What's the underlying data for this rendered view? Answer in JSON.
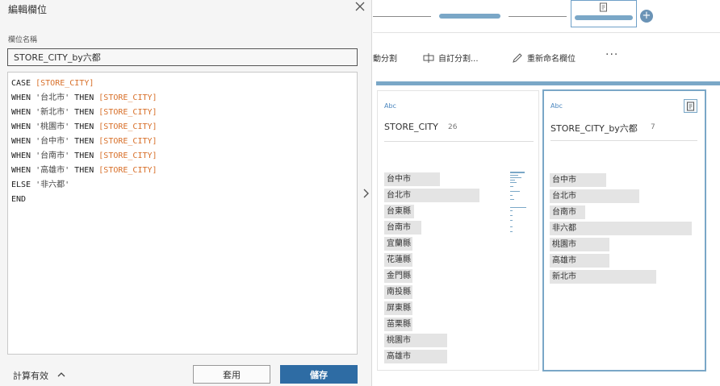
{
  "dialog": {
    "title": "編輯欄位",
    "field_label": "欄位名稱",
    "field_name_value": "STORE_CITY_by六都",
    "code_lines": [
      [
        {
          "t": "CASE ",
          "c": "kw"
        },
        {
          "t": "[STORE_CITY]",
          "c": "field"
        }
      ],
      [
        {
          "t": "WHEN ",
          "c": "kw"
        },
        {
          "t": "'台北市'",
          "c": "str"
        },
        {
          "t": " THEN ",
          "c": "kw"
        },
        {
          "t": "[STORE_CITY]",
          "c": "field"
        }
      ],
      [
        {
          "t": "WHEN ",
          "c": "kw"
        },
        {
          "t": "'新北市'",
          "c": "str"
        },
        {
          "t": " THEN ",
          "c": "kw"
        },
        {
          "t": "[STORE_CITY]",
          "c": "field"
        }
      ],
      [
        {
          "t": "WHEN ",
          "c": "kw"
        },
        {
          "t": "'桃園市'",
          "c": "str"
        },
        {
          "t": " THEN ",
          "c": "kw"
        },
        {
          "t": "[STORE_CITY]",
          "c": "field"
        }
      ],
      [
        {
          "t": "WHEN ",
          "c": "kw"
        },
        {
          "t": "'台中市'",
          "c": "str"
        },
        {
          "t": " THEN ",
          "c": "kw"
        },
        {
          "t": "[STORE_CITY]",
          "c": "field"
        }
      ],
      [
        {
          "t": "WHEN ",
          "c": "kw"
        },
        {
          "t": "'台南市'",
          "c": "str"
        },
        {
          "t": " THEN ",
          "c": "kw"
        },
        {
          "t": "[STORE_CITY]",
          "c": "field"
        }
      ],
      [
        {
          "t": "WHEN ",
          "c": "kw"
        },
        {
          "t": "'高雄市'",
          "c": "str"
        },
        {
          "t": " THEN ",
          "c": "kw"
        },
        {
          "t": "[STORE_CITY]",
          "c": "field"
        }
      ],
      [
        {
          "t": "ELSE ",
          "c": "kw"
        },
        {
          "t": "'非六都'",
          "c": "str"
        }
      ],
      [
        {
          "t": "END",
          "c": "kw"
        }
      ]
    ],
    "valid_label": "計算有效",
    "apply_label": "套用",
    "save_label": "儲存"
  },
  "toolbar": {
    "split_label": "動分割",
    "custom_split_label": "自訂分割...",
    "rename_label": "重新命名欄位",
    "more_label": "···"
  },
  "cards": {
    "store_city": {
      "type_label": "Abc",
      "name": "STORE_CITY",
      "count": "26",
      "values": [
        {
          "label": "台中市",
          "fill": 0.56
        },
        {
          "label": "台北市",
          "fill": 0.95
        },
        {
          "label": "台東縣",
          "fill": 0.3
        },
        {
          "label": "台南市",
          "fill": 0.37
        },
        {
          "label": "宜蘭縣",
          "fill": 0.28
        },
        {
          "label": "花蓮縣",
          "fill": 0.28
        },
        {
          "label": "金門縣",
          "fill": 0.28
        },
        {
          "label": "南投縣",
          "fill": 0.28
        },
        {
          "label": "屏東縣",
          "fill": 0.28
        },
        {
          "label": "苗栗縣",
          "fill": 0.28
        },
        {
          "label": "桃園市",
          "fill": 0.63
        },
        {
          "label": "高雄市",
          "fill": 0.63
        }
      ]
    },
    "store_city_by6": {
      "type_label": "Abc",
      "name": "STORE_CITY_by六都",
      "count": "7",
      "values": [
        {
          "label": "台中市",
          "fill": 0.4
        },
        {
          "label": "台北市",
          "fill": 0.63
        },
        {
          "label": "台南市",
          "fill": 0.25
        },
        {
          "label": "非六都",
          "fill": 1.0
        },
        {
          "label": "桃園市",
          "fill": 0.42
        },
        {
          "label": "高雄市",
          "fill": 0.42
        },
        {
          "label": "新北市",
          "fill": 0.75
        }
      ]
    }
  },
  "colors": {
    "accent": "#2e6ca4",
    "field_ref": "#d8702a",
    "flow_step": "#7aa7c7"
  }
}
